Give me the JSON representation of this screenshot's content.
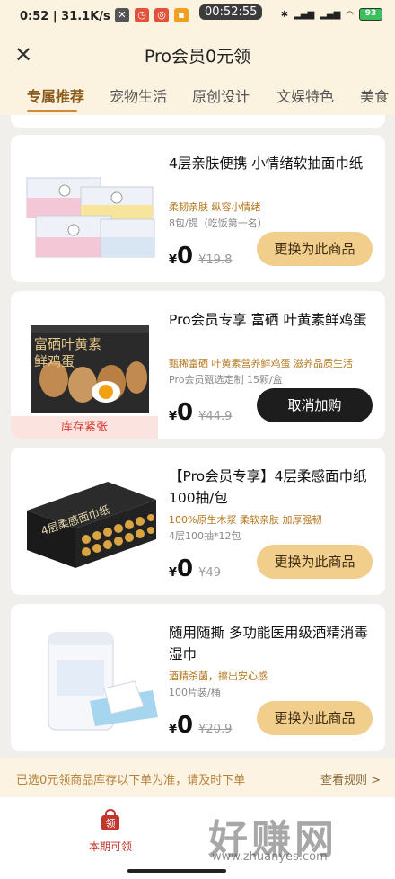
{
  "status": {
    "time": "0:52",
    "net_speed": "31.1K/s",
    "clock_pill": "00:52:55",
    "battery": "93"
  },
  "header": {
    "title": "Pro会员0元领"
  },
  "tabs": [
    {
      "label": "专属推荐",
      "active": true
    },
    {
      "label": "宠物生活"
    },
    {
      "label": "原创设计"
    },
    {
      "label": "文娱特色"
    },
    {
      "label": "美食"
    }
  ],
  "products": [
    {
      "name": "4层亲肤便携 小情绪软抽面巾纸",
      "tags": "柔韧亲肤 纵容小情绪",
      "spec": "8包/提（吃饭第一名）",
      "currency": "¥",
      "price": "0",
      "original_price": "¥19.8",
      "button": "更换为此商品"
    },
    {
      "name": "Pro会员专享 富硒 叶黄素鲜鸡蛋",
      "tags": "甄稀富硒 叶黄素营养鲜鸡蛋 滋养品质生活",
      "spec": "Pro会员甄选定制 15颗/盒",
      "currency": "¥",
      "price": "0",
      "original_price": "¥44.9",
      "button": "取消加购",
      "badge": "库存紧张",
      "box_text": "富硒叶黄素鲜鸡蛋"
    },
    {
      "name": "【Pro会员专享】4层柔感面巾纸 100抽/包",
      "tags": "100%原生木浆 柔软亲肤 加厚强韧",
      "spec": "4层100抽*12包",
      "currency": "¥",
      "price": "0",
      "original_price": "¥49",
      "button": "更换为此商品",
      "box_text": "4层柔感面巾纸"
    },
    {
      "name": "随用随撕 多功能医用级酒精消毒湿巾",
      "tags": "酒精杀菌，擦出安心感",
      "spec": "100片装/桶",
      "currency": "¥",
      "price": "0",
      "original_price": "¥20.9",
      "button": "更换为此商品"
    }
  ],
  "notice": {
    "text": "已选0元领商品库存以下单为准，请及时下单",
    "rule_link": "查看规则 >"
  },
  "bottom_nav": {
    "icon_char": "领",
    "label": "本期可领"
  },
  "watermark": {
    "text": "好赚网",
    "url": "www.zhuanyes.com"
  },
  "colors": {
    "header_bg": "#fbf2df",
    "accent": "#c98a3a",
    "button_gold": "#f1ce8c",
    "button_dark": "#1d1d1d",
    "stock_red": "#d8362c"
  }
}
